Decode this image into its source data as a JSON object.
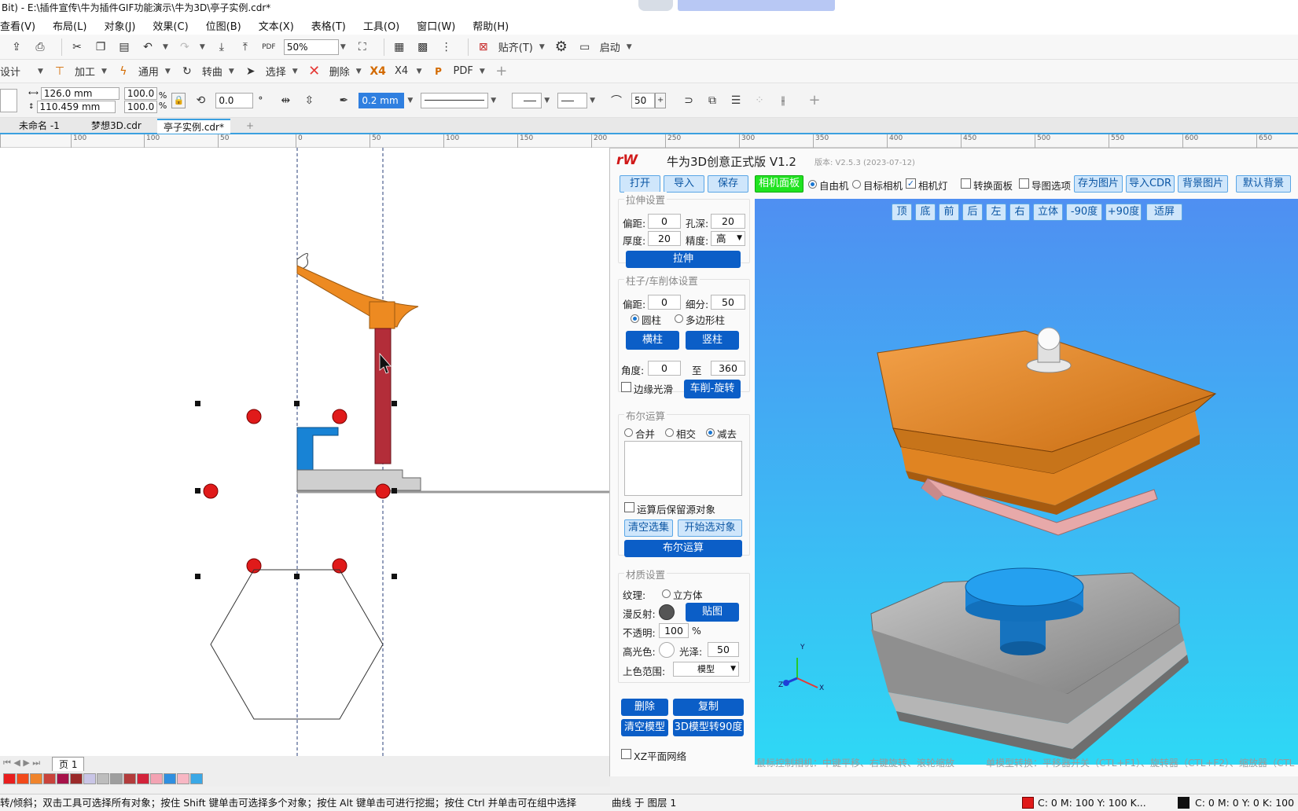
{
  "window": {
    "title": "Bit) - E:\\插件宣传\\牛为插件GIF功能演示\\牛为3D\\亭子实例.cdr*"
  },
  "menu": [
    "查看(V)",
    "布局(L)",
    "对象(J)",
    "效果(C)",
    "位图(B)",
    "文本(X)",
    "表格(T)",
    "工具(O)",
    "窗口(W)",
    "帮助(H)"
  ],
  "toolbar1": {
    "zoom_value": "50%",
    "snap_label": "贴齐(T)",
    "launch_label": "启动"
  },
  "toolbar2": {
    "design_label": "设计",
    "process_label": "加工",
    "general_label": "通用",
    "curve_label": "转曲",
    "select_label": "选择",
    "delete_label": "删除",
    "x4_label": "X4",
    "pdf_label": "PDF"
  },
  "propbar": {
    "width": "126.0 mm",
    "height": "110.459 mm",
    "scale_w": "100.0",
    "scale_h": "100.0",
    "percent": "%",
    "rotation": "0.0",
    "degree": "°",
    "outline_width": "0.2 mm",
    "smooth_value": "50"
  },
  "doc_tabs": [
    "未命名 -1",
    "梦想3D.cdr",
    "亭子实例.cdr*"
  ],
  "ruler_ticks": [
    "100",
    "150",
    "100",
    "50",
    "0",
    "50",
    "100",
    "150",
    "200",
    "250",
    "300",
    "350",
    "400",
    "450",
    "500",
    "550",
    "600",
    "650"
  ],
  "page_tab": "页 1",
  "palette_colors": [
    "#e81e1e",
    "#f24a1b",
    "#f0842c",
    "#c9433b",
    "#a7124a",
    "#9b2a2a",
    "#c9c5e6",
    "#bdbdbd",
    "#9e9e9e",
    "#b33c3c",
    "#d3233b",
    "#f3a3b3",
    "#2f8fe0",
    "#f8b7c4",
    "#3aa8e6"
  ],
  "status": {
    "hint": "转/倾斜；双击工具可选择所有对象；按住 Shift 键单击可选择多个对象；按住 Alt 键单击可进行挖掘；按住 Ctrl 并单击可在组中选择",
    "layer_info": "曲线 于 图层 1",
    "fill_info": "C: 0 M: 100 Y: 100 K...",
    "outline_info": "C: 0 M: 0 Y: 0 K: 100"
  },
  "plugin": {
    "logo": "rW",
    "title": "牛为3D创意正式版 V1.2",
    "version": "版本: V2.5.3  (2023-07-12)",
    "top_buttons": {
      "open": "打开",
      "import": "导入",
      "save": "保存",
      "camera_panel": "相机面板",
      "free_cam": "自由机",
      "target_cam": "目标相机",
      "cam_light": "相机灯",
      "switch_panel": "转换面板",
      "export_opt": "导图选项",
      "save_image": "存为图片",
      "import_cdr": "导入CDR",
      "bg_image": "背景图片",
      "default_bg": "默认背景"
    },
    "extrude": {
      "group_title": "拉伸设置",
      "offset_label": "偏距:",
      "offset_value": "0",
      "hole_label": "孔深:",
      "hole_value": "20",
      "thickness_label": "厚度:",
      "thickness_value": "20",
      "precision_label": "精度:",
      "precision_value": "高",
      "button": "拉伸"
    },
    "column": {
      "group_title": "柱子/车削体设置",
      "offset_label": "偏距:",
      "offset_value": "0",
      "subdiv_label": "细分:",
      "subdiv_value": "50",
      "cylinder": "圆柱",
      "polygon": "多边形柱",
      "hcol": "横柱",
      "vcol": "竖柱",
      "angle_label": "角度:",
      "angle_from": "0",
      "to_label": "至",
      "angle_to": "360",
      "smooth_edge": "边缘光滑",
      "lathe": "车削-旋转"
    },
    "boolean": {
      "group_title": "布尔运算",
      "union": "合并",
      "intersect": "相交",
      "subtract": "减去",
      "keep_source": "运算后保留源对象",
      "clear_sel": "清空选集",
      "start_sel": "开始选对象",
      "run": "布尔运算"
    },
    "material": {
      "group_title": "材质设置",
      "texture_label": "纹理:",
      "cube": "立方体",
      "diffuse_label": "漫反射:",
      "map_button": "贴图",
      "opacity_label": "不透明:",
      "opacity_value": "100",
      "opacity_unit": "%",
      "spec_label": "高光色:",
      "gloss_label": "光泽:",
      "gloss_value": "50",
      "range_label": "上色范围:",
      "range_value": "模型"
    },
    "actions": {
      "delete": "删除",
      "copy": "复制",
      "clear_model": "清空模型",
      "rotate90": "3D模型转90度"
    },
    "xz_grid": "XZ平面网络",
    "view_buttons": [
      "顶",
      "底",
      "前",
      "后",
      "左",
      "右",
      "立体",
      "-90度",
      "+90度",
      "适屏"
    ],
    "hint_left": "鼠标控制相机：中键平移、右键旋转、滚轮缩放",
    "hint_right": "单模型转换：平移器开关（CTL+F1）、旋转器（CTL+F2）、缩放器（CTL",
    "axis_labels": {
      "x": "X",
      "y": "Y",
      "z": "Z"
    }
  },
  "colors": {
    "accent_blue": "#0b5ec7",
    "roof_orange": "#e8892b",
    "base_gray": "#a9a9a9",
    "cylinder_blue": "#1c89d6",
    "viewport_top": "#4f8ff2",
    "viewport_bottom": "#2ed8f5"
  }
}
